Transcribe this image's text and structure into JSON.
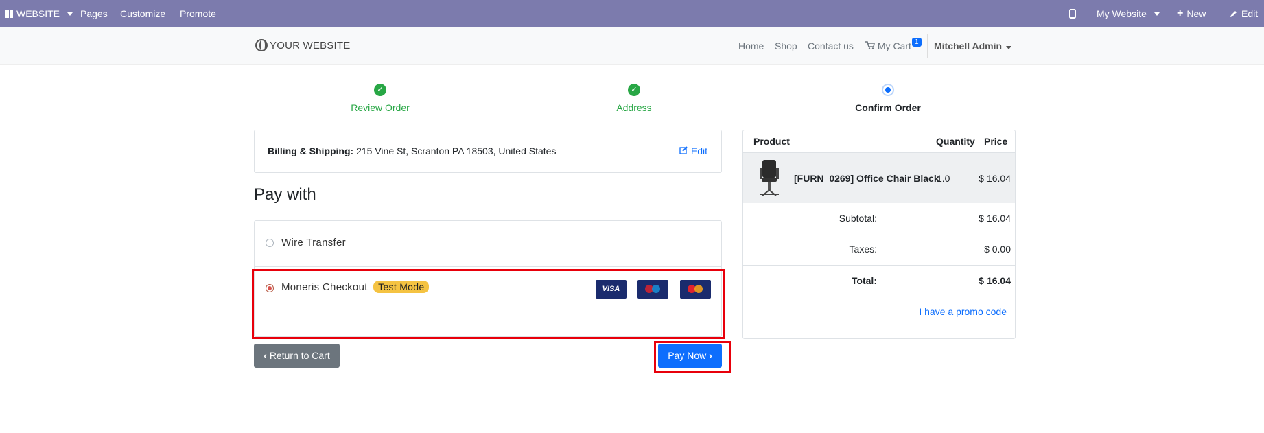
{
  "adminbar": {
    "website": "WEBSITE",
    "pages": "Pages",
    "customize": "Customize",
    "promote": "Promote",
    "my_website": "My Website",
    "new": "New",
    "edit": "Edit"
  },
  "header": {
    "logo": "YOUR WEBSITE",
    "nav": [
      "Home",
      "Shop",
      "Contact us"
    ],
    "cart": "My Cart",
    "cart_count": "1",
    "user": "Mitchell Admin"
  },
  "steps": [
    {
      "label": "Review Order",
      "state": "done"
    },
    {
      "label": "Address",
      "state": "done"
    },
    {
      "label": "Confirm Order",
      "state": "current"
    }
  ],
  "billing": {
    "label": "Billing & Shipping:",
    "address": "215 Vine St, Scranton PA 18503, United States",
    "edit": "Edit"
  },
  "pay_with": {
    "title": "Pay with",
    "methods": [
      {
        "label": "Wire Transfer",
        "selected": false
      },
      {
        "label": "Moneris Checkout",
        "badge": "Test Mode",
        "selected": true
      }
    ],
    "card_logos": [
      "VISA",
      "Maestro",
      "MasterCard"
    ]
  },
  "buttons": {
    "return": "Return to Cart",
    "pay": "Pay Now"
  },
  "summary": {
    "headers": {
      "product": "Product",
      "quantity": "Quantity",
      "price": "Price"
    },
    "item": {
      "name": "[FURN_0269] Office Chair Black",
      "quantity": "1.0",
      "price": "$ 16.04"
    },
    "subtotal_label": "Subtotal:",
    "subtotal": "$ 16.04",
    "taxes_label": "Taxes:",
    "taxes": "$ 0.00",
    "total_label": "Total:",
    "total": "$ 16.04",
    "promo": "I have a promo code"
  },
  "colors": {
    "adminbar": "#7c7bad",
    "primary": "#0d6efd",
    "success": "#28a745",
    "highlight": "#e8000b",
    "badge": "#f5c342"
  }
}
